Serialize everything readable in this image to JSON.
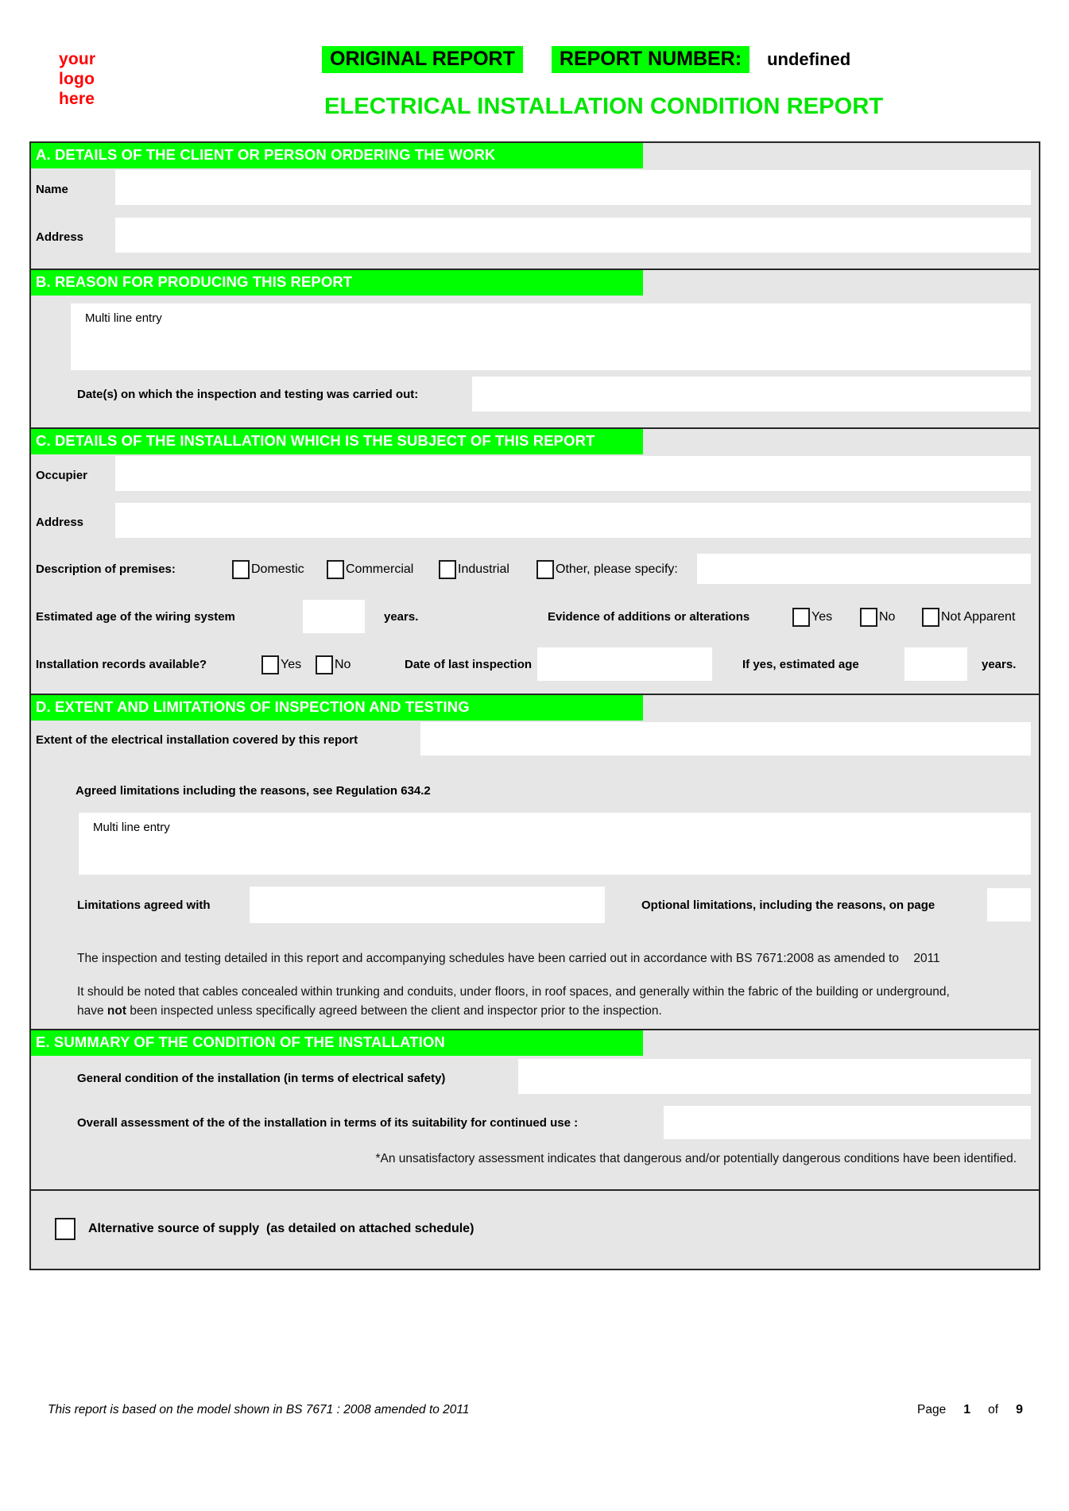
{
  "header": {
    "logo_line1": "your",
    "logo_line2": "logo",
    "logo_line3": "here",
    "original_report": "ORIGINAL REPORT",
    "report_number_label": "REPORT NUMBER:",
    "report_number_value": "undefined",
    "title": "ELECTRICAL INSTALLATION CONDITION REPORT",
    "highlight_color": "#00ff00",
    "title_color": "#00e600",
    "logo_color": "#ff0000"
  },
  "section_a": {
    "heading": "A. DETAILS OF THE CLIENT OR PERSON ORDERING THE WORK",
    "name_label": "Name",
    "name_value": "",
    "address_label": "Address",
    "address_value": ""
  },
  "section_b": {
    "heading": "B. REASON FOR PRODUCING THIS REPORT",
    "multiline_placeholder": "Multi line entry",
    "multiline_value": "",
    "dates_label": "Date(s) on which the inspection and testing was carried out:",
    "dates_value": ""
  },
  "section_c": {
    "heading": "C. DETAILS OF THE INSTALLATION WHICH IS THE SUBJECT OF THIS REPORT",
    "occupier_label": "Occupier",
    "occupier_value": "",
    "address_label": "Address",
    "address_value": "",
    "premises_label": "Description of premises:",
    "premises_options": [
      "Domestic",
      "Commercial",
      "Industrial",
      "Other, please specify:"
    ],
    "premises_other_value": "",
    "age_label": "Estimated age of the wiring system",
    "age_value": "",
    "years_label": "years.",
    "evidence_label": "Evidence of additions or alterations",
    "evidence_options": [
      "Yes",
      "No",
      "Not Apparent"
    ],
    "records_label": "Installation records available?",
    "records_options": [
      "Yes",
      "No"
    ],
    "last_inspection_label": "Date of last inspection",
    "last_inspection_value": "",
    "if_yes_age_label": "If yes, estimated age",
    "if_yes_age_value": "",
    "if_yes_years_label": "years."
  },
  "section_d": {
    "heading": "D. EXTENT AND LIMITATIONS OF INSPECTION AND TESTING",
    "extent_label": "Extent of the electrical installation covered by this report",
    "extent_value": "",
    "agreed_label": "Agreed limitations including the reasons, see Regulation 634.2",
    "multiline_placeholder": "Multi line entry",
    "multiline_value": "",
    "limitations_agreed_label": "Limitations agreed with",
    "limitations_agreed_value": "",
    "optional_limitations_label": "Optional limitations, including the reasons, on page",
    "optional_limitations_value": "",
    "para1": "The inspection and testing detailed in this report and accompanying schedules have been carried out in accordance with BS 7671:2008 as amended to",
    "para1_year": "2011",
    "para2_a": "It should be noted that cables concealed within trunking and conduits, under floors, in roof spaces, and generally within the fabric of the building or underground,",
    "para2_b_pre": "have ",
    "para2_b_bold": "not",
    "para2_b_post": " been inspected unless specifically agreed between the client and inspector prior to the inspection."
  },
  "section_e": {
    "heading": "E. SUMMARY OF THE CONDITION OF THE INSTALLATION",
    "general_condition_label": "General condition of the installation (in terms of electrical safety)",
    "general_condition_value": "",
    "overall_label": "Overall assessment of the of the installation in terms of its suitability for continued use :",
    "overall_value": "",
    "note": "*An unsatisfactory assessment indicates that dangerous and/or potentially dangerous conditions have been identified."
  },
  "section_f": {
    "alt_supply_label": "Alternative source of supply",
    "alt_supply_suffix": "(as detailed on attached schedule)"
  },
  "footer": {
    "note": "This report is based on the model shown in BS 7671 : 2008 amended to 2011",
    "page_label": "Page",
    "page_number": "1",
    "of_label": "of",
    "page_total": "9"
  }
}
